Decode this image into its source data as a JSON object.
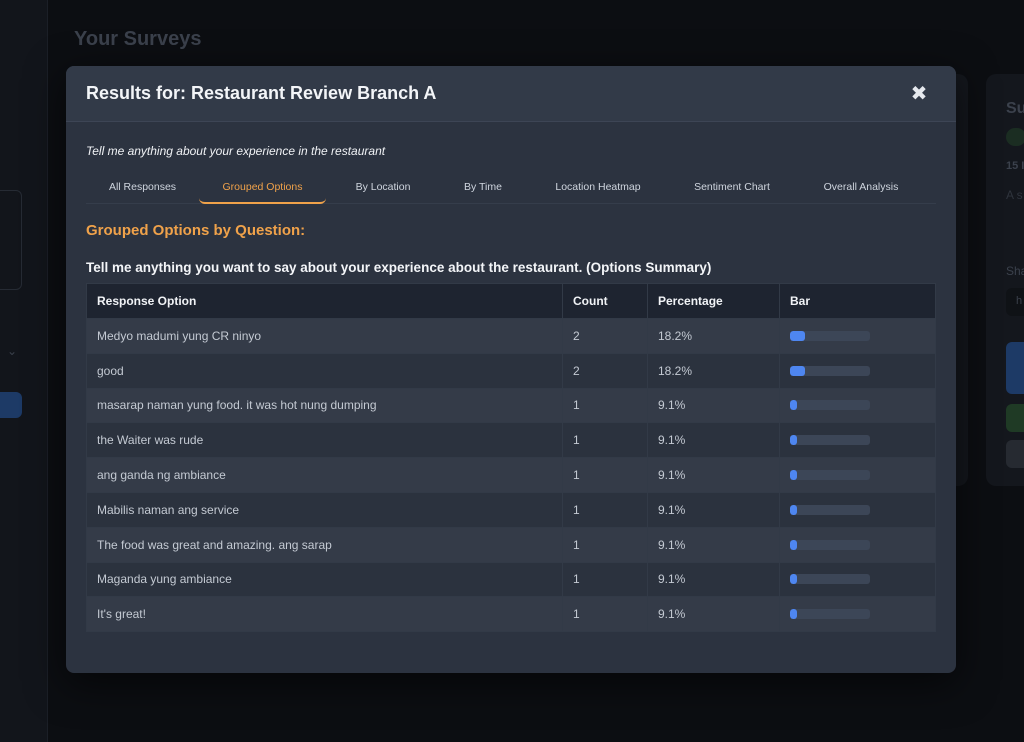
{
  "background": {
    "page_title": "Your Surveys",
    "card_title": "Su",
    "card_badge": "A",
    "card_count": "15 I",
    "card_text": "A s",
    "card_share_label": "Sha",
    "card_input_value": "h"
  },
  "modal": {
    "title": "Results for: Restaurant Review Branch A",
    "close_icon": "close-icon",
    "question": "Tell me anything about your experience in the restaurant",
    "tabs": [
      {
        "label": "All Responses",
        "active": false
      },
      {
        "label": "Grouped Options",
        "active": true
      },
      {
        "label": "By Location",
        "active": false
      },
      {
        "label": "By Time",
        "active": false
      },
      {
        "label": "Location Heatmap",
        "active": false
      },
      {
        "label": "Sentiment Chart",
        "active": false
      },
      {
        "label": "Overall Analysis",
        "active": false
      }
    ],
    "section_title": "Grouped Options by Question:",
    "table_caption": "Tell me anything you want to say about your experience about the restaurant. (Options Summary)",
    "columns": [
      "Response Option",
      "Count",
      "Percentage",
      "Bar"
    ],
    "rows": [
      {
        "option": "Medyo madumi yung CR ninyo",
        "count": "2",
        "percentage": "18.2%",
        "bar_fraction": 0.182
      },
      {
        "option": "good",
        "count": "2",
        "percentage": "18.2%",
        "bar_fraction": 0.182
      },
      {
        "option": "masarap naman yung food. it was hot nung dumping",
        "count": "1",
        "percentage": "9.1%",
        "bar_fraction": 0.091
      },
      {
        "option": "the Waiter was rude",
        "count": "1",
        "percentage": "9.1%",
        "bar_fraction": 0.091
      },
      {
        "option": "ang ganda ng ambiance",
        "count": "1",
        "percentage": "9.1%",
        "bar_fraction": 0.091
      },
      {
        "option": "Mabilis naman ang service",
        "count": "1",
        "percentage": "9.1%",
        "bar_fraction": 0.091
      },
      {
        "option": "The food was great and amazing. ang sarap",
        "count": "1",
        "percentage": "9.1%",
        "bar_fraction": 0.091
      },
      {
        "option": "Maganda yung ambiance",
        "count": "1",
        "percentage": "9.1%",
        "bar_fraction": 0.091
      },
      {
        "option": "It's great!",
        "count": "1",
        "percentage": "9.1%",
        "bar_fraction": 0.091
      }
    ]
  },
  "colors": {
    "accent": "#f0a24a",
    "bar": "#4e86f0",
    "modal_bg": "#2c3340"
  }
}
